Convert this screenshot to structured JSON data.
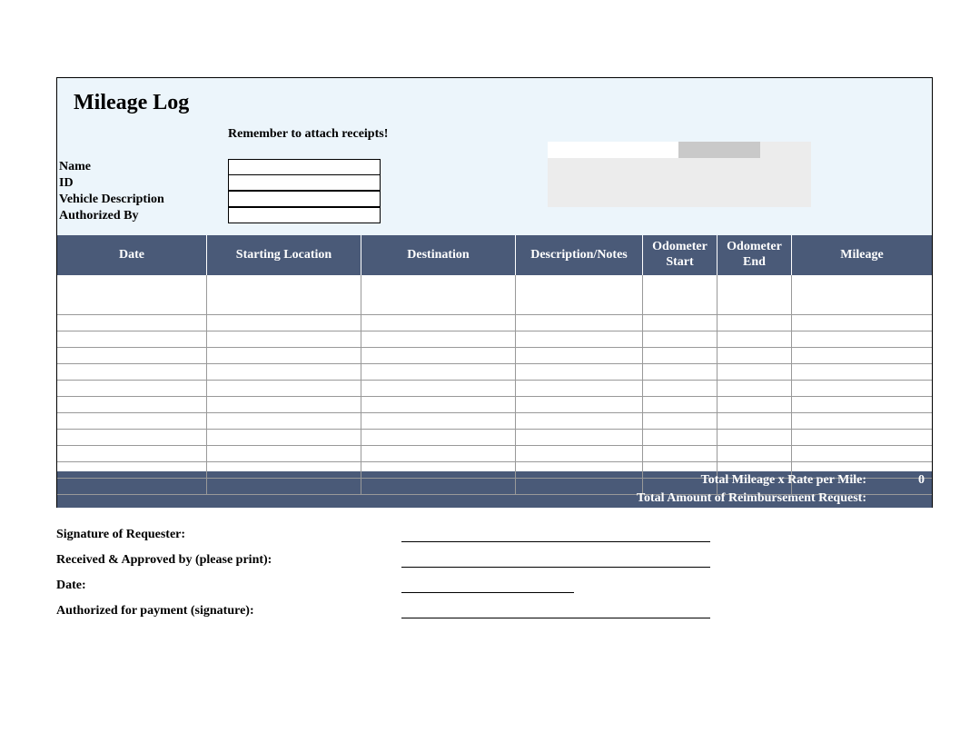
{
  "title": "Mileage Log",
  "reminder": "Remember to attach receipts!",
  "info": {
    "name_label": "Name",
    "id_label": "ID",
    "vehicle_label": "Vehicle Description",
    "authorized_label": "Authorized By",
    "name_value": "",
    "id_value": "",
    "vehicle_value": "",
    "authorized_value": ""
  },
  "columns": {
    "date": "Date",
    "starting_location": "Starting Location",
    "destination": "Destination",
    "description": "Description/Notes",
    "odometer_start": "Odometer Start",
    "odometer_end": "Odometer End",
    "mileage": "Mileage"
  },
  "row_count": 12,
  "totals": {
    "rate_label": "Total Mileage x Rate per Mile:",
    "rate_value": "0",
    "reimbursement_label": "Total Amount of Reimbursement Request:",
    "reimbursement_value": ""
  },
  "signatures": {
    "requester": "Signature of Requester:",
    "approved": "Received & Approved by (please print):",
    "date": "Date:",
    "payment": "Authorized for payment (signature):"
  }
}
